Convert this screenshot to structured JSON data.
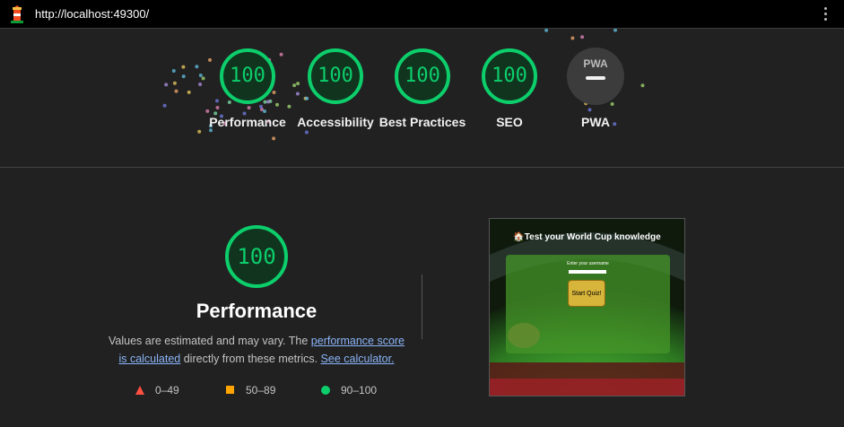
{
  "browser": {
    "url": "http://localhost:49300/"
  },
  "summary": [
    {
      "score": "100",
      "label": "Performance"
    },
    {
      "score": "100",
      "label": "Accessibility"
    },
    {
      "score": "100",
      "label": "Best Practices"
    },
    {
      "score": "100",
      "label": "SEO"
    },
    {
      "score": "",
      "label": "PWA",
      "badge": "PWA"
    }
  ],
  "performance": {
    "score": "100",
    "title": "Performance",
    "desc_prefix": "Values are estimated and may vary. The ",
    "link1": "performance score is calculated",
    "desc_middle": " directly from these metrics. ",
    "link2": "See calculator.",
    "legend": [
      {
        "range": "0–49",
        "color": "#ff4e42",
        "shape": "triangle"
      },
      {
        "range": "50–89",
        "color": "#ffa400",
        "shape": "square"
      },
      {
        "range": "90–100",
        "color": "#0cce6b",
        "shape": "circle"
      }
    ]
  },
  "screenshot": {
    "title": "🏠Test your World Cup knowledge",
    "enter_label": "Enter your username",
    "button": "Start Quiz!"
  },
  "colors": {
    "pass": "#0cce6b",
    "background": "#212121"
  }
}
